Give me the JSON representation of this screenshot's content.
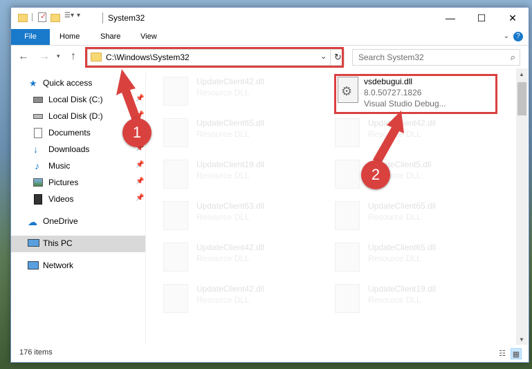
{
  "window": {
    "title": "System32",
    "controls": {
      "minimize": "—",
      "maximize": "☐",
      "close": "✕"
    }
  },
  "ribbon": {
    "tabs": [
      "File",
      "Home",
      "Share",
      "View"
    ],
    "help": "?"
  },
  "navigation": {
    "address": "C:\\Windows\\System32",
    "search_placeholder": "Search System32"
  },
  "sidebar": {
    "items": [
      {
        "label": "Quick access",
        "icon": "star-icon",
        "pinned": false
      },
      {
        "label": "Local Disk (C:)",
        "icon": "drive-icon",
        "pinned": true
      },
      {
        "label": "Local Disk (D:)",
        "icon": "drive-icon",
        "pinned": true
      },
      {
        "label": "Documents",
        "icon": "documents-icon",
        "pinned": true
      },
      {
        "label": "Downloads",
        "icon": "download-icon",
        "pinned": true
      },
      {
        "label": "Music",
        "icon": "music-icon",
        "pinned": true
      },
      {
        "label": "Pictures",
        "icon": "pictures-icon",
        "pinned": true
      },
      {
        "label": "Videos",
        "icon": "videos-icon",
        "pinned": true
      },
      {
        "label": "OneDrive",
        "icon": "cloud-icon",
        "pinned": false
      },
      {
        "label": "This PC",
        "icon": "computer-icon",
        "pinned": false,
        "selected": true
      },
      {
        "label": "Network",
        "icon": "network-icon",
        "pinned": false
      }
    ]
  },
  "files": {
    "highlighted": {
      "name": "vsdebugui.dll",
      "version": "8.0.50727.1826",
      "description": "Visual Studio Debug..."
    },
    "ghost_left": [
      {
        "name": "UpdateClient42.dll",
        "type": "Resource DLL"
      },
      {
        "name": "UpdateClient65.dll",
        "type": "Resource DLL"
      },
      {
        "name": "UpdateClient19.dll",
        "type": "Resource DLL"
      },
      {
        "name": "UpdateClient63.dll",
        "type": "Resource DLL"
      },
      {
        "name": "UpdateClient42.dll",
        "type": "Resource DLL"
      },
      {
        "name": "UpdateClient42.dll",
        "type": "Resource DLL"
      }
    ],
    "ghost_right": [
      {
        "name": "UpdateClient42.dll",
        "type": "Resource DLL"
      },
      {
        "name": "UpdateClient5.dll",
        "type": "Resource DLL"
      },
      {
        "name": "UpdateClient65.dll",
        "type": "Resource DLL"
      },
      {
        "name": "UpdateClient65.dll",
        "type": "Resource DLL"
      },
      {
        "name": "UpdateClient19.dll",
        "type": "Resource DLL"
      }
    ]
  },
  "status": {
    "item_count": "176 items"
  },
  "callouts": [
    "1",
    "2"
  ],
  "colors": {
    "accent": "#1979ca",
    "highlight": "#d9413f",
    "selection": "#d9d9d9"
  }
}
